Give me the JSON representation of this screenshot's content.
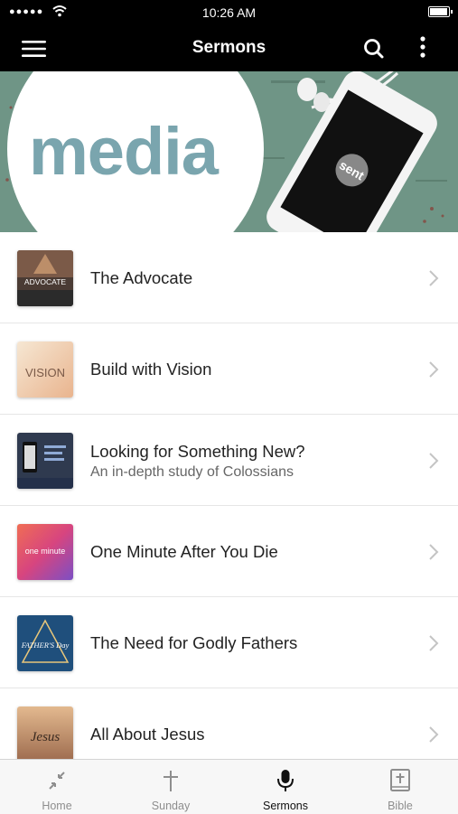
{
  "status_bar": {
    "signal": "●●●●●",
    "time": "10:26 AM"
  },
  "nav": {
    "title": "Sermons",
    "menu_icon": "hamburger-menu-icon",
    "search_icon": "search-icon",
    "more_icon": "more-vertical-icon"
  },
  "banner": {
    "word": "media",
    "phone_logo": "sent"
  },
  "sermons": [
    {
      "title": "The Advocate",
      "subtitle": "",
      "thumb_text": "ADVOCATE"
    },
    {
      "title": "Build with Vision",
      "subtitle": "",
      "thumb_text": "VISION"
    },
    {
      "title": "Looking for Something New?",
      "subtitle": "An in-depth study of Colossians",
      "thumb_text": ""
    },
    {
      "title": "One Minute After You Die",
      "subtitle": "",
      "thumb_text": "one minute"
    },
    {
      "title": "The Need for Godly Fathers",
      "subtitle": "",
      "thumb_text": "FATHER'S Day"
    },
    {
      "title": "All About Jesus",
      "subtitle": "",
      "thumb_text": "Jesus"
    }
  ],
  "tabs": [
    {
      "label": "Home",
      "icon": "home-arrows-icon",
      "active": false
    },
    {
      "label": "Sunday",
      "icon": "cross-icon",
      "active": false
    },
    {
      "label": "Sermons",
      "icon": "microphone-icon",
      "active": true
    },
    {
      "label": "Bible",
      "icon": "bible-icon",
      "active": false
    }
  ],
  "colors": {
    "bar_background": "#000000",
    "banner_green": "#6f9586",
    "banner_text": "#7aa5ae",
    "active_tab": "#111111",
    "inactive_tab": "#8e8e8e"
  }
}
